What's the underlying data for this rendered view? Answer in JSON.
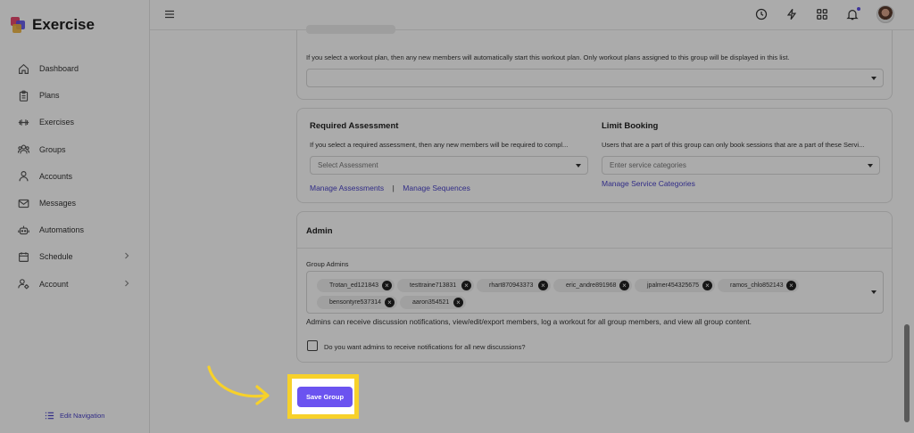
{
  "app": {
    "title": "Exercise"
  },
  "sidebar": {
    "items": [
      {
        "label": "Dashboard",
        "icon": "home-icon"
      },
      {
        "label": "Plans",
        "icon": "clipboard-icon"
      },
      {
        "label": "Exercises",
        "icon": "dumbbell-icon"
      },
      {
        "label": "Groups",
        "icon": "users-icon"
      },
      {
        "label": "Accounts",
        "icon": "user-icon"
      },
      {
        "label": "Messages",
        "icon": "mail-icon"
      },
      {
        "label": "Automations",
        "icon": "robot-icon"
      },
      {
        "label": "Schedule",
        "icon": "calendar-icon",
        "has_submenu": true
      },
      {
        "label": "Account",
        "icon": "user-gear-icon",
        "has_submenu": true
      }
    ],
    "edit_navigation": "Edit Navigation"
  },
  "workout": {
    "hint": "If you select a workout plan, then any new members will automatically start this workout plan. Only workout plans assigned to this group will be displayed in this list.",
    "select_value": ""
  },
  "assessment": {
    "title": "Required Assessment",
    "hint": "If you select a required assessment, then any new members will be required to compl...",
    "placeholder": "Select Assessment",
    "link_assessments": "Manage Assessments",
    "separator": "|",
    "link_sequences": "Manage Sequences"
  },
  "booking": {
    "title": "Limit Booking",
    "hint": "Users that are a part of this group can only book sessions that are a part of these Servi...",
    "placeholder": "Enter service categories",
    "link": "Manage Service Categories"
  },
  "admin": {
    "title": "Admin",
    "group_admins_label": "Group Admins",
    "admins": [
      "Trotan_ed121843",
      "testtraine713831",
      "rhart870943373",
      "eric_andre891968",
      "jpalmer454325675",
      "ramos_chlo852143",
      "bensontyre537314",
      "aaron354521"
    ],
    "description": "Admins can receive discussion notifications, view/edit/export members, log a workout for all group members, and view all group content.",
    "notify_label": "Do you want admins to receive notifications for all new discussions?",
    "notify_checked": false
  },
  "actions": {
    "save_label": "Save Group"
  },
  "colors": {
    "accent": "#6b53f0",
    "link": "#4a43c9",
    "highlight": "#f7d12a"
  }
}
